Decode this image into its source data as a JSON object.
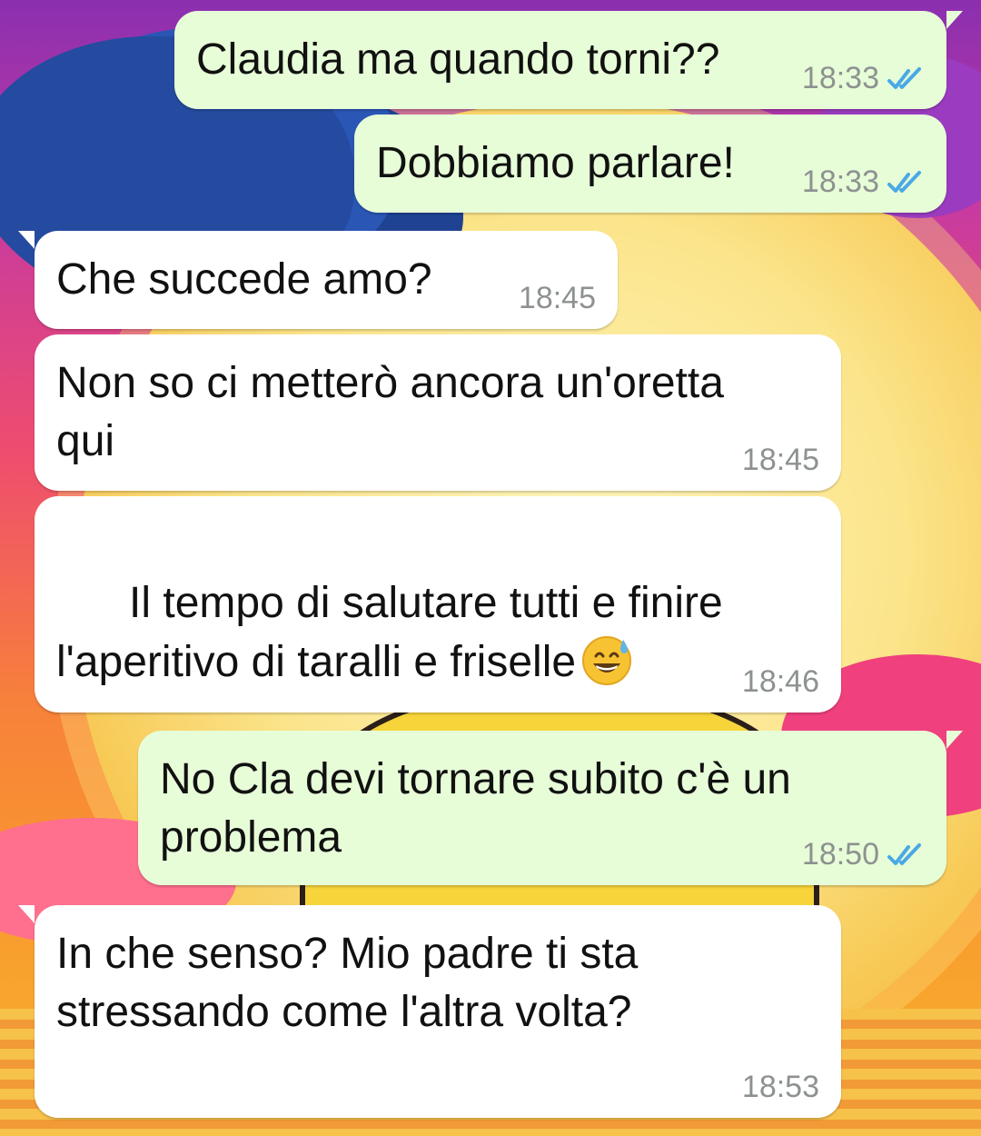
{
  "colors": {
    "outgoing_bubble": "#e7fdd8",
    "incoming_bubble": "#ffffff",
    "timestamp": "#8d9290",
    "read_ticks": "#4aa9e5"
  },
  "messages": [
    {
      "direction": "out",
      "text": "Claudia ma quando torni??",
      "time": "18:33",
      "status": "read"
    },
    {
      "direction": "out",
      "text": "Dobbiamo parlare!",
      "time": "18:33",
      "status": "read"
    },
    {
      "direction": "in",
      "text": "Che succede amo?",
      "time": "18:45"
    },
    {
      "direction": "in",
      "text": "Non so ci metterò ancora un'oretta\nqui",
      "time": "18:45"
    },
    {
      "direction": "in",
      "text": "Il tempo di salutare tutti e finire\nl'aperitivo di taralli e friselle",
      "emoji": "grinning-sweat-emoji",
      "time": "18:46"
    },
    {
      "direction": "out",
      "text": "No Cla devi tornare subito c'è un\nproblema",
      "time": "18:50",
      "status": "read"
    },
    {
      "direction": "in",
      "text": "In che senso? Mio padre ti sta\nstressando come l'altra volta?",
      "time": "18:53"
    }
  ]
}
